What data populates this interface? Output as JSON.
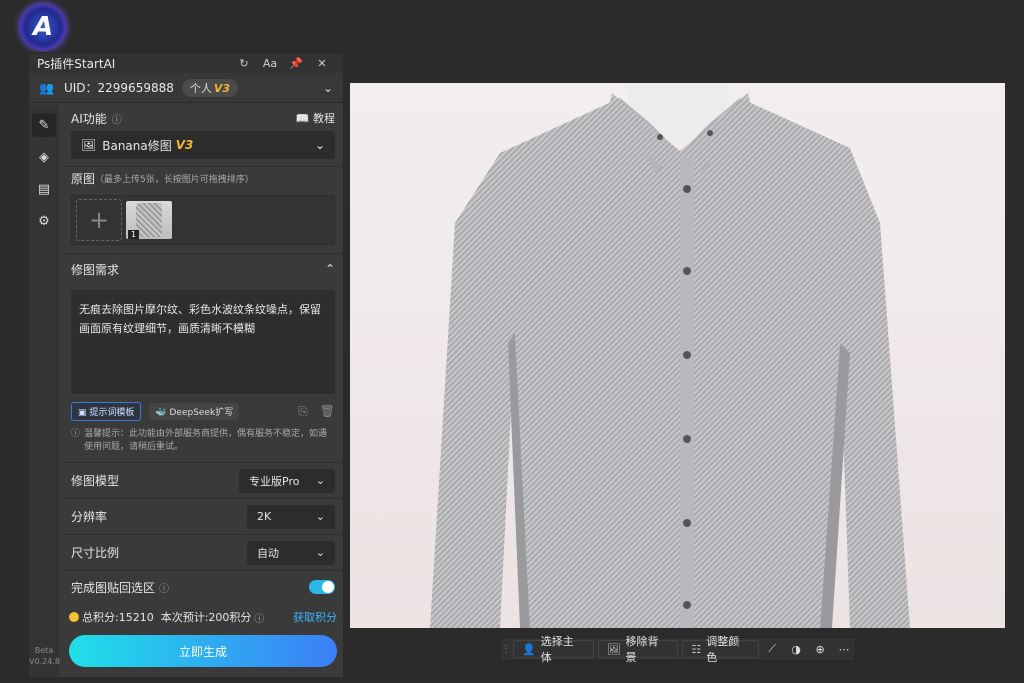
{
  "logo": {
    "letter": "A"
  },
  "panel": {
    "title": "Ps插件StartAI",
    "uid": "UID：2299659888",
    "badge_label": "个人",
    "badge_version": "V3",
    "version_line1": "Beta",
    "version_line2": "V0.24.8"
  },
  "ai": {
    "section_label": "AI功能",
    "tutorial_label": "教程",
    "model_select": "Banana修图",
    "model_version": "V3"
  },
  "original": {
    "label": "原图",
    "hint": "（最多上传5张，长按图片可拖拽排序）",
    "thumb_number": "1"
  },
  "request": {
    "label": "修图需求",
    "text": "无痕去除图片摩尔纹、彩色水波纹条纹噪点，保留画面原有纹理细节，画质清晰不模糊",
    "template_button": "提示词模板",
    "deepseek_button": "DeepSeek扩写",
    "notice": "温馨提示：此功能由外部服务商提供，偶有服务不稳定，如遇使用问题，请稍后重试。"
  },
  "settings": {
    "model_label": "修图模型",
    "model_value": "专业版Pro",
    "resolution_label": "分辨率",
    "resolution_value": "2K",
    "ratio_label": "尺寸比例",
    "ratio_value": "自动",
    "paste_label": "完成图贴回选区",
    "paste_enabled": true
  },
  "footer": {
    "credits": "总积分:15210",
    "estimate": "本次预计:200积分",
    "get_credits": "获取积分",
    "generate": "立即生成"
  },
  "toolbar": {
    "select_subject": "选择主体",
    "remove_bg": "移除背景",
    "adjust_color": "调整颜色"
  },
  "colors": {
    "accent": "#2bb6e8",
    "link": "#3ab4ff",
    "gold": "#f2b534"
  }
}
